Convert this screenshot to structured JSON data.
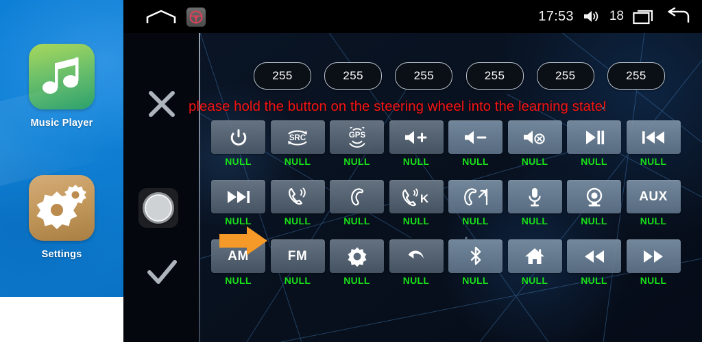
{
  "sidebar": {
    "apps": [
      {
        "label": "Music Player",
        "icon": "music-note-icon"
      },
      {
        "label": "Settings",
        "icon": "gears-icon"
      }
    ]
  },
  "statusbar": {
    "home_icon": "home-outline-icon",
    "wheel_icon": "steering-wheel-icon",
    "time": "17:53",
    "volume_icon": "volume-icon",
    "volume_value": "18",
    "recent_icon": "recent-apps-icon",
    "back_icon": "back-arrow-icon"
  },
  "controls": {
    "cancel_icon": "close-x-icon",
    "knob_icon": "rotary-knob-icon",
    "confirm_icon": "checkmark-icon",
    "pointer_icon": "orange-arrow-icon"
  },
  "values": {
    "pills": [
      "255",
      "255",
      "255",
      "255",
      "255",
      "255"
    ]
  },
  "message": {
    "warning": "please hold the button on the steering wheel into the learning state!",
    "warning_color": "#f51414"
  },
  "grid": {
    "label_color": "#19e019",
    "rows": [
      [
        {
          "icon": "power-icon",
          "text": "",
          "label": "NULL"
        },
        {
          "icon": "src-icon",
          "text": "",
          "label": "NULL"
        },
        {
          "icon": "gps-icon",
          "text": "",
          "label": "NULL"
        },
        {
          "icon": "volume-up-icon",
          "text": "",
          "label": "NULL"
        },
        {
          "icon": "volume-down-icon",
          "text": "",
          "label": "NULL"
        },
        {
          "icon": "mute-icon",
          "text": "",
          "label": "NULL"
        },
        {
          "icon": "play-pause-icon",
          "text": "",
          "label": "NULL"
        },
        {
          "icon": "previous-track-icon",
          "text": "",
          "label": "NULL"
        }
      ],
      [
        {
          "icon": "next-track-icon",
          "text": "",
          "label": "NULL"
        },
        {
          "icon": "answer-call-icon",
          "text": "",
          "label": "NULL"
        },
        {
          "icon": "hang-up-icon",
          "text": "",
          "label": "NULL"
        },
        {
          "icon": "call-k-icon",
          "text": "",
          "label": "NULL"
        },
        {
          "icon": "hang-up-arrow-icon",
          "text": "",
          "label": "NULL"
        },
        {
          "icon": "microphone-icon",
          "text": "",
          "label": "NULL"
        },
        {
          "icon": "camera-icon",
          "text": "",
          "label": "NULL"
        },
        {
          "icon": "",
          "text": "AUX",
          "label": "NULL"
        }
      ],
      [
        {
          "icon": "",
          "text": "AM",
          "label": "NULL"
        },
        {
          "icon": "",
          "text": "FM",
          "label": "NULL"
        },
        {
          "icon": "brightness-icon",
          "text": "",
          "label": "NULL"
        },
        {
          "icon": "back-curve-icon",
          "text": "",
          "label": "NULL"
        },
        {
          "icon": "bluetooth-icon",
          "text": "",
          "label": "NULL"
        },
        {
          "icon": "home-filled-icon",
          "text": "",
          "label": "NULL"
        },
        {
          "icon": "rewind-icon",
          "text": "",
          "label": "NULL"
        },
        {
          "icon": "fast-forward-icon",
          "text": "",
          "label": "NULL"
        }
      ]
    ]
  }
}
